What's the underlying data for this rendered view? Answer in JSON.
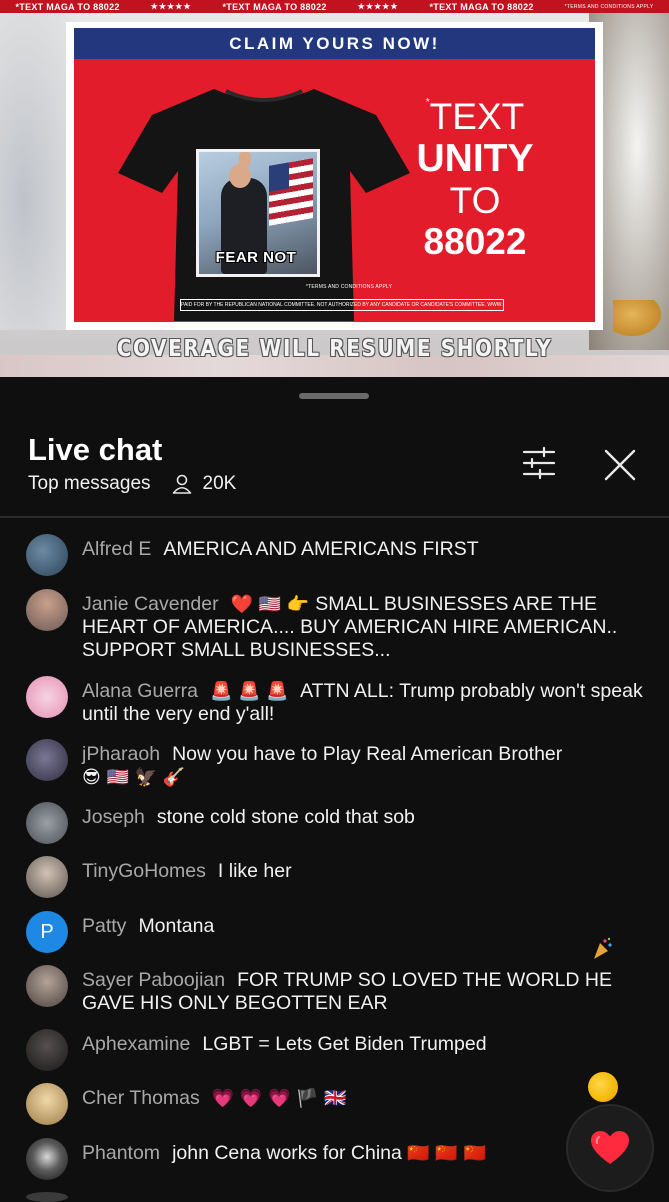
{
  "video": {
    "ticker": [
      {
        "text": "*TEXT MAGA TO 88022",
        "stars": "★★★★★"
      },
      {
        "text": "*TEXT MAGA TO 88022",
        "stars": "★★★★★"
      },
      {
        "text": "*TEXT MAGA TO 88022",
        "stars": ""
      }
    ],
    "ticker_fine": "*TERMS AND CONDITIONS APPLY",
    "ad": {
      "banner": "CLAIM YOURS NOW!",
      "shirt_text": "FEAR NOT",
      "line1": "TEXT",
      "line2": "UNITY",
      "line3": "TO",
      "line4": "88022",
      "terms": "*TERMS AND CONDITIONS APPLY",
      "disclaimer": "PAID FOR BY THE REPUBLICAN NATIONAL COMMITTEE. NOT AUTHORIZED BY ANY CANDIDATE OR CANDIDATE'S COMMITTEE. WWW.GOP.COM"
    },
    "overlay": "COVERAGE WILL RESUME SHORTLY"
  },
  "chat": {
    "title": "Live chat",
    "mode": "Top messages",
    "viewers": "20K",
    "messages": [
      {
        "author": "Alfred E",
        "text": "AMERICA AND AMERICANS FIRST",
        "emoji": "",
        "avatar": "#3b5f7a"
      },
      {
        "author": "Janie Cavender",
        "text": "SMALL BUSINESSES ARE THE HEART OF AMERICA.... BUY AMERICAN HIRE AMERICAN.. SUPPORT SMALL BUSINESSES...",
        "emoji": "❤️ 🇺🇸 👉",
        "avatar": "#8a6e6a"
      },
      {
        "author": "Alana Guerra",
        "text": "ATTN ALL: Trump probably won't speak until the very end y'all!",
        "emoji": "🚨 🚨 🚨",
        "avatar": "#e9a9c3"
      },
      {
        "author": "jPharaoh",
        "text": "Now you have to Play Real American Brother",
        "emoji": "😎 🇺🇸 🦅 🎸",
        "avatar": "#4d4a63"
      },
      {
        "author": "Joseph",
        "text": "stone cold stone cold that sob",
        "emoji": "",
        "avatar": "#6c7176"
      },
      {
        "author": "TinyGoHomes",
        "text": "I like her",
        "emoji": "",
        "avatar": "#9a8f87"
      },
      {
        "author": "Patty",
        "text": "Montana",
        "emoji": "",
        "avatar": "P"
      },
      {
        "author": "Sayer Paboojian",
        "text": "FOR TRUMP SO LOVED THE WORLD HE GAVE HIS ONLY BEGOTTEN EAR",
        "emoji": "",
        "avatar": "#7a6b64"
      },
      {
        "author": "Aphexamine",
        "text": "LGBT = Lets Get Biden Trumped",
        "emoji": "",
        "avatar": "#2b2a2f"
      },
      {
        "author": "Cher Thomas",
        "text": "",
        "emoji": "💗 💗 💗 🏴 🇬🇧",
        "avatar": "#c9a46a"
      },
      {
        "author": "Phantom",
        "text": "john Cena works for China",
        "emoji": "🇨🇳 🇨🇳 🇨🇳",
        "avatar": "#5a5a5a"
      }
    ]
  },
  "colors": {
    "accent_red": "#e21c2b",
    "banner_blue": "#22377d",
    "panel_bg": "#0f0f0f",
    "author_gray": "#a8a8a8",
    "heart": "#ff2a3d"
  },
  "icons": {
    "filter": "sliders-icon",
    "close": "close-icon",
    "viewers": "person-icon",
    "like": "heart-icon"
  }
}
